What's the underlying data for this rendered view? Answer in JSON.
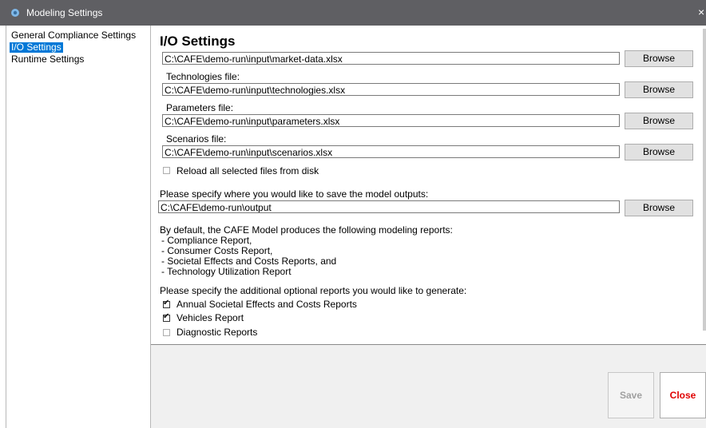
{
  "window": {
    "title": "Modeling Settings",
    "close_glyph": "×"
  },
  "nav": {
    "items": [
      {
        "label": "General Compliance Settings",
        "selected": false
      },
      {
        "label": "I/O Settings",
        "selected": true
      },
      {
        "label": "Runtime Settings",
        "selected": false
      }
    ]
  },
  "io": {
    "heading": "I/O Settings",
    "market_file": {
      "value": "C:\\CAFE\\demo-run\\input\\market-data.xlsx",
      "browse": "Browse"
    },
    "technologies_file": {
      "label": "Technologies file:",
      "value": "C:\\CAFE\\demo-run\\input\\technologies.xlsx",
      "browse": "Browse"
    },
    "parameters_file": {
      "label": "Parameters file:",
      "value": "C:\\CAFE\\demo-run\\input\\parameters.xlsx",
      "browse": "Browse"
    },
    "scenarios_file": {
      "label": "Scenarios file:",
      "value": "C:\\CAFE\\demo-run\\input\\scenarios.xlsx",
      "browse": "Browse"
    },
    "reload": {
      "label": "Reload all selected files from disk",
      "checked": false
    },
    "output": {
      "label": "Please specify where you would like to save the model outputs:",
      "value": "C:\\CAFE\\demo-run\\output",
      "browse": "Browse"
    },
    "default_reports": {
      "intro": "By default, the CAFE Model produces the following modeling reports:",
      "items": [
        " - Compliance Report,",
        " - Consumer Costs  Report,",
        " - Societal Effects and Costs Reports, and",
        " - Technology Utilization Report"
      ]
    },
    "optional_reports": {
      "intro": "Please specify the additional optional reports you would like to generate:",
      "items": [
        {
          "label": "Annual Societal Effects and Costs Reports",
          "checked": true
        },
        {
          "label": "Vehicles Report",
          "checked": true
        },
        {
          "label": "Diagnostic Reports",
          "checked": false
        }
      ]
    }
  },
  "footer": {
    "save": "Save",
    "close": "Close"
  },
  "colors": {
    "titlebar": "#5f5f63",
    "selection": "#0078d7",
    "close_text": "#e00000"
  },
  "icons": {
    "app": "gear-icon"
  }
}
